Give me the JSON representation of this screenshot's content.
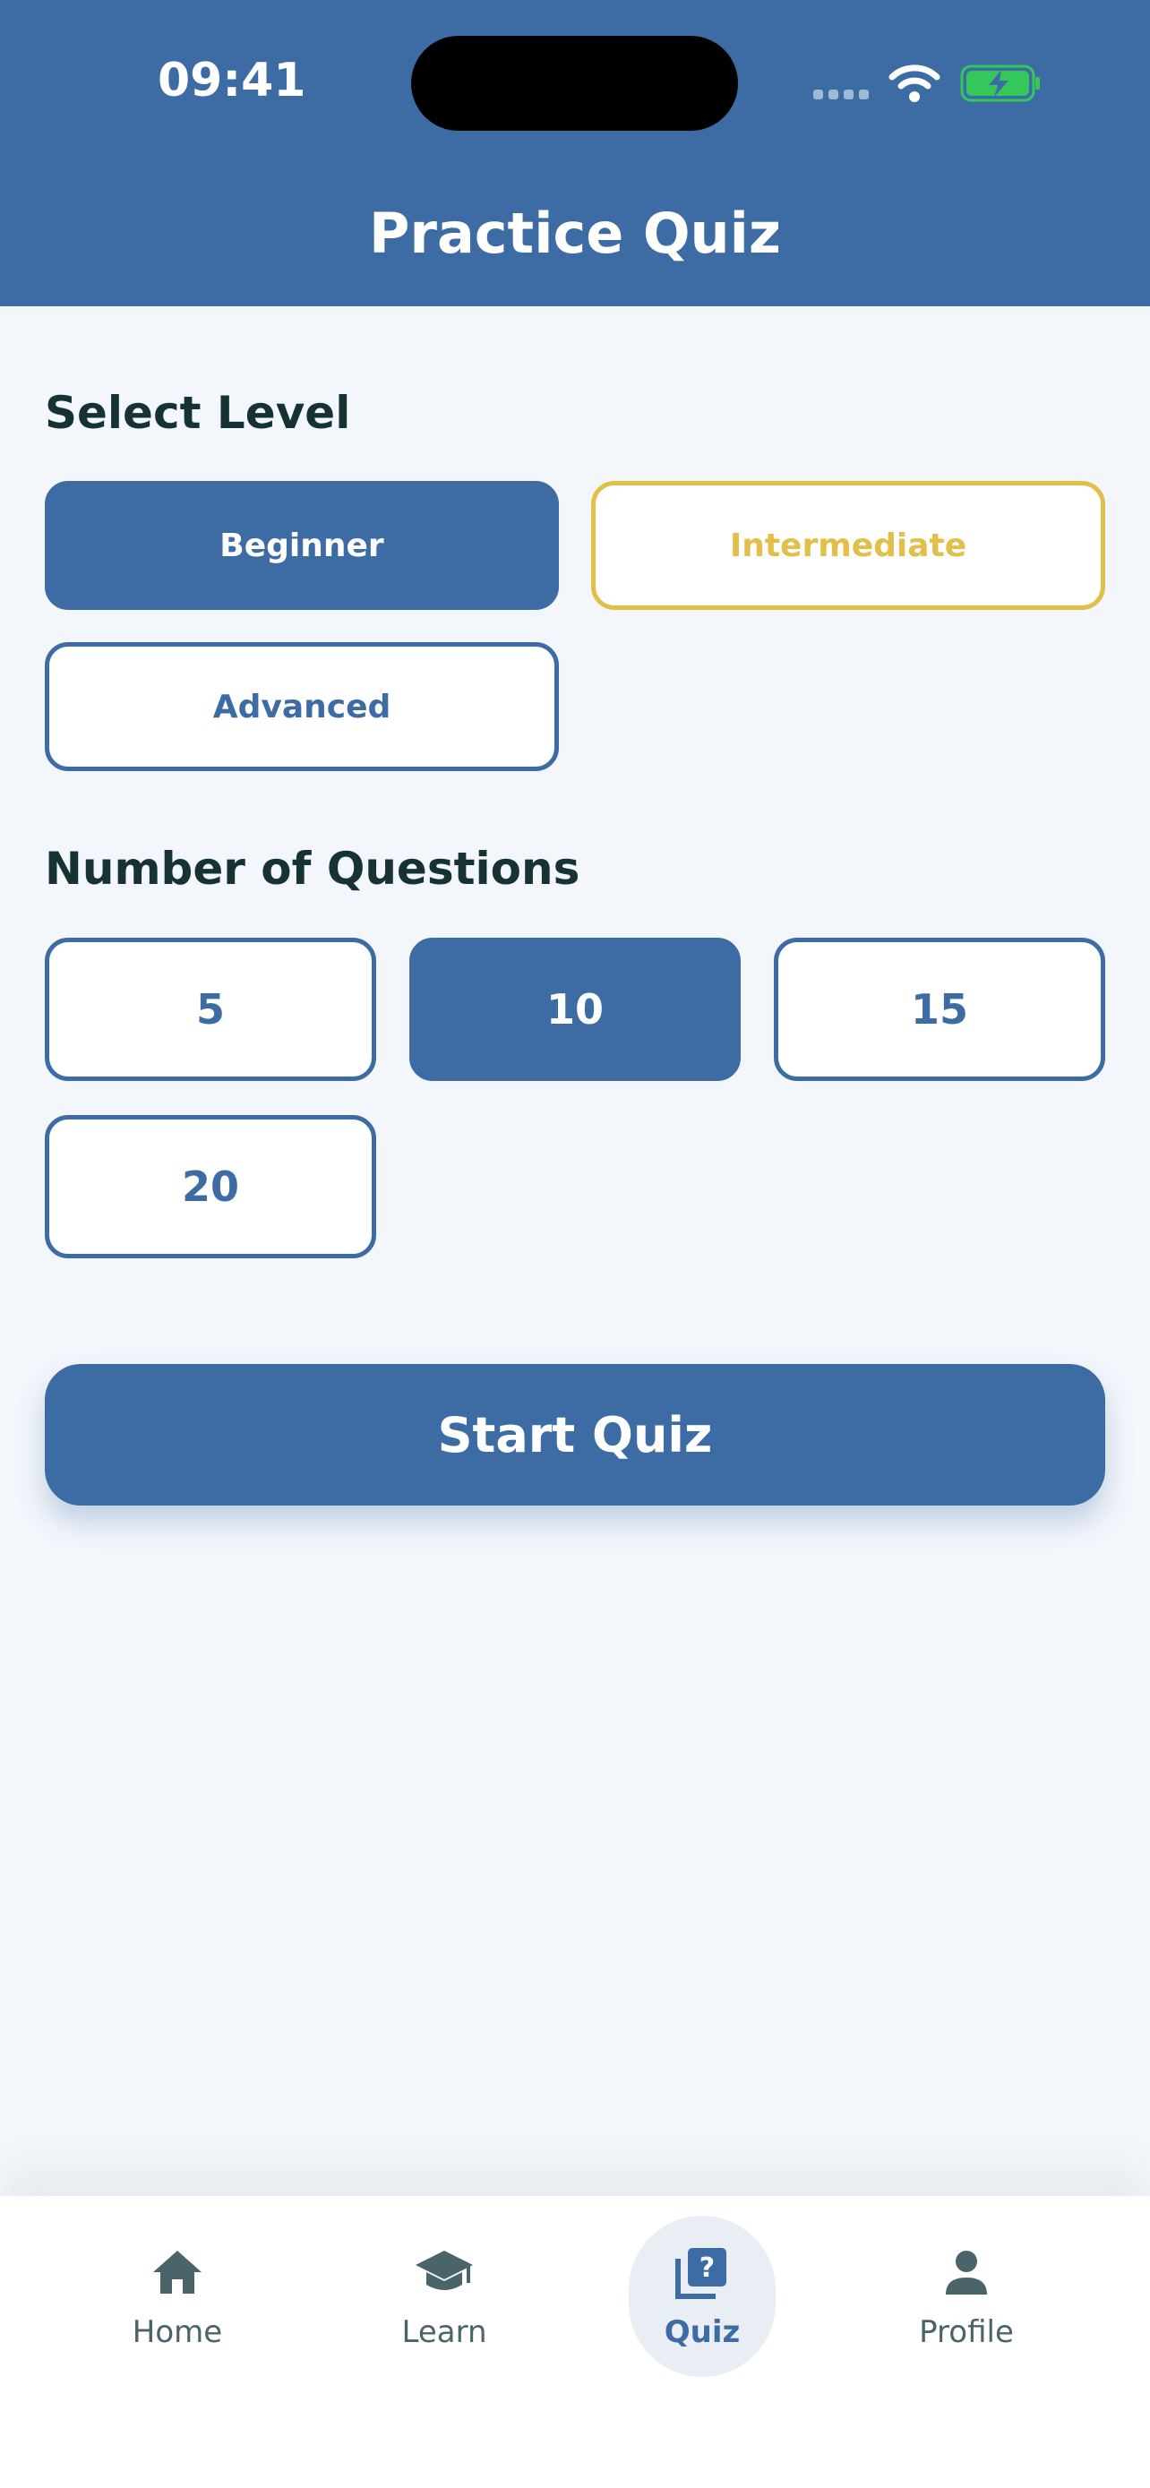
{
  "status_bar": {
    "time": "09:41"
  },
  "header": {
    "title": "Practice Quiz"
  },
  "level": {
    "label": "Select Level",
    "options": [
      {
        "label": "Beginner",
        "state": "selected"
      },
      {
        "label": "Intermediate",
        "state": "highlighted"
      },
      {
        "label": "Advanced",
        "state": "default"
      }
    ]
  },
  "questions": {
    "label": "Number of Questions",
    "options": [
      {
        "label": "5",
        "state": "default"
      },
      {
        "label": "10",
        "state": "selected"
      },
      {
        "label": "15",
        "state": "default"
      },
      {
        "label": "20",
        "state": "default"
      }
    ]
  },
  "start_button": {
    "label": "Start Quiz"
  },
  "nav": {
    "items": [
      {
        "label": "Home",
        "icon": "home-icon"
      },
      {
        "label": "Learn",
        "icon": "graduation-cap-icon"
      },
      {
        "label": "Quiz",
        "icon": "quiz-icon",
        "active": true
      },
      {
        "label": "Profile",
        "icon": "person-icon"
      }
    ]
  },
  "colors": {
    "primary": "#3d6ca5",
    "accent": "#e2bf49",
    "background": "#f3f6fb",
    "heading": "#173235",
    "battery": "#34c759"
  }
}
